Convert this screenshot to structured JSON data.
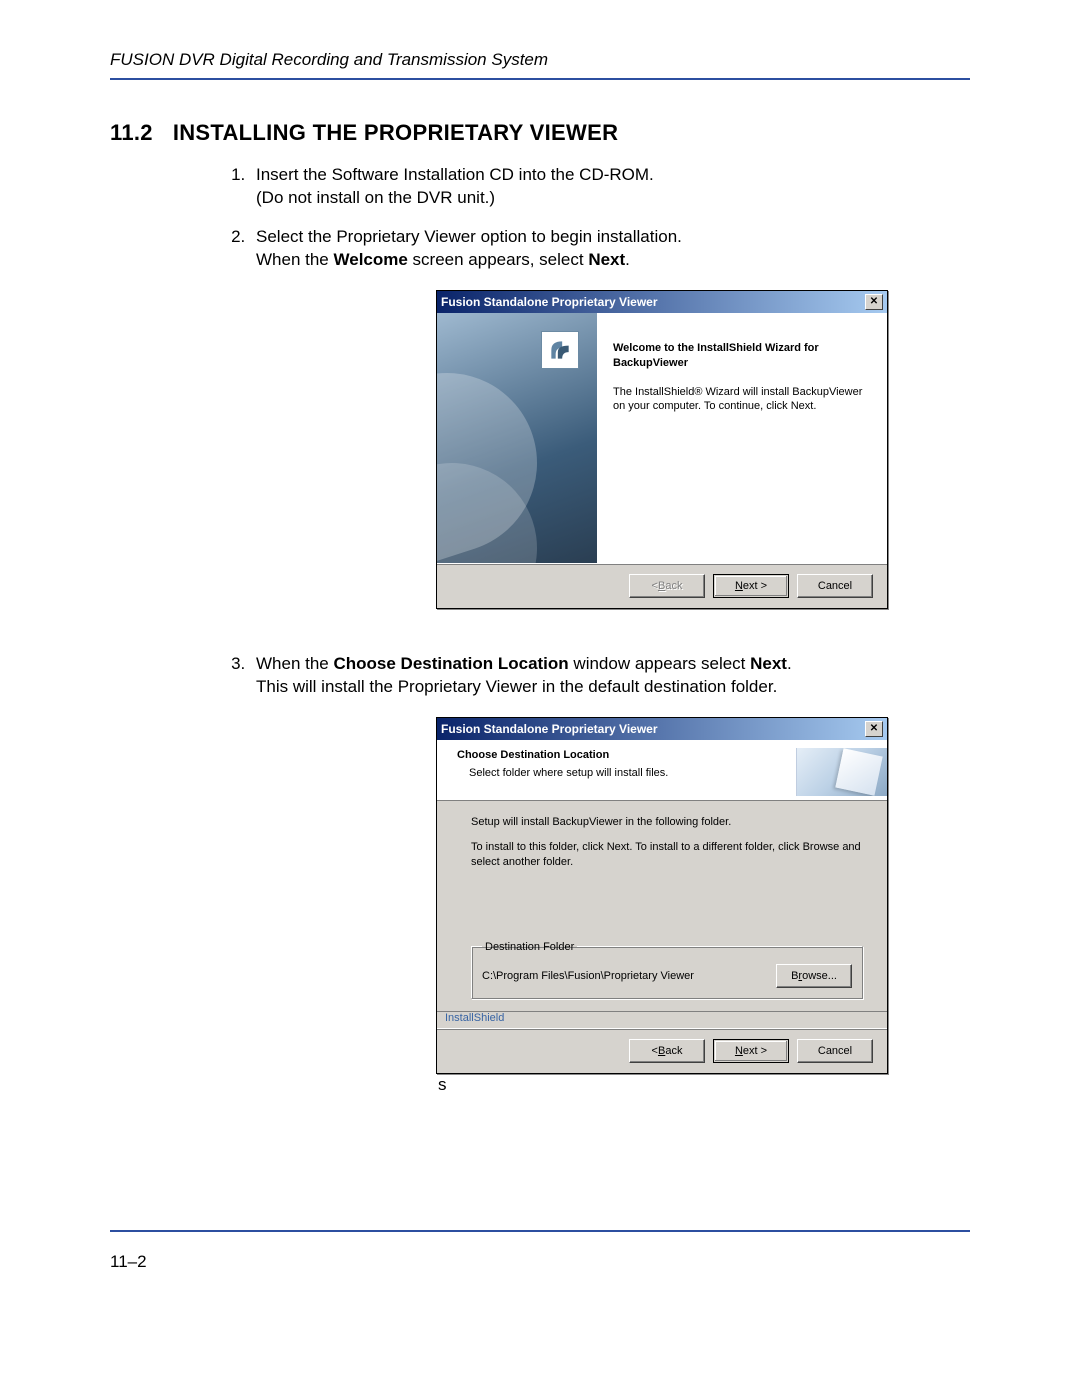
{
  "header": "FUSION DVR Digital Recording and Transmission System",
  "section_number": "11.2",
  "section_title": "INSTALLING THE PROPRIETARY VIEWER",
  "steps": {
    "s1a": "Insert the Software Installation CD into the CD-ROM.",
    "s1b": "(Do not install on the DVR unit.)",
    "s2a": "Select the Proprietary Viewer option to begin installation.",
    "s2b_pre": "When the ",
    "s2b_bold": "Welcome",
    "s2b_post": " screen appears, select ",
    "s2b_bold2": "Next",
    "s2b_end": ".",
    "s3a_pre": "When the ",
    "s3a_bold": "Choose Destination Location",
    "s3a_mid": " window appears select ",
    "s3a_bold2": "Next",
    "s3a_end": ".",
    "s3b": "This will install the Proprietary Viewer in the default destination folder."
  },
  "dialog1": {
    "title": "Fusion Standalone Proprietary Viewer",
    "welcome": "Welcome to the InstallShield Wizard for BackupViewer",
    "desc": "The InstallShield® Wizard will install BackupViewer on your computer.  To continue, click Next.",
    "back": "< Back",
    "next": "Next >",
    "cancel": "Cancel"
  },
  "dialog2": {
    "title": "Fusion Standalone Proprietary Viewer",
    "h_title": "Choose Destination Location",
    "h_sub": "Select folder where setup will install files.",
    "line1": "Setup will install BackupViewer in the following folder.",
    "line2": "To install to this folder, click Next. To install to a different folder, click Browse and select another folder.",
    "legend": "Destination Folder",
    "path": "C:\\Program Files\\Fusion\\Proprietary Viewer",
    "browse": "Browse...",
    "brand": "InstallShield",
    "back": "< Back",
    "next": "Next >",
    "cancel": "Cancel"
  },
  "trail_s": "s",
  "page_number": "11–2"
}
